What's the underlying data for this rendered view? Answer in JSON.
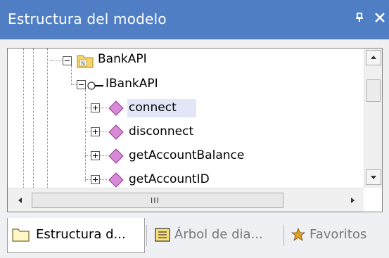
{
  "window": {
    "title": "Estructura del modelo",
    "pin_glyph": "ᵩ",
    "close_glyph": "✕",
    "pin_icon": "pin-icon",
    "close_icon": "close-icon"
  },
  "tree": {
    "items": [
      {
        "label": "BankAPI",
        "expanded": true,
        "icon": "package-folder-icon",
        "level": 0
      },
      {
        "label": "IBankAPI",
        "expanded": true,
        "icon": "interface-icon",
        "level": 1
      },
      {
        "label": "connect",
        "expanded": false,
        "icon": "operation-diamond-icon",
        "level": 2,
        "selected": true
      },
      {
        "label": "disconnect",
        "expanded": false,
        "icon": "operation-diamond-icon",
        "level": 2
      },
      {
        "label": "getAccountBalance",
        "expanded": false,
        "icon": "operation-diamond-icon",
        "level": 2
      },
      {
        "label": "getAccountID",
        "expanded": false,
        "icon": "operation-diamond-icon",
        "level": 2
      }
    ],
    "package_badge": "N"
  },
  "scrollbars": {
    "grip": "III"
  },
  "tabs": [
    {
      "label": "Estructura d...",
      "icon": "folder-icon",
      "active": true
    },
    {
      "label": "Árbol de dia...",
      "icon": "diagram-tree-icon",
      "active": false
    },
    {
      "label": "Favoritos",
      "icon": "favorites-star-icon",
      "active": false
    }
  ],
  "colors": {
    "titlebar": "#4f7ec4",
    "selection": "#e3e6f7",
    "diamond": "#d88ad8",
    "folder": "#f5d66b"
  }
}
